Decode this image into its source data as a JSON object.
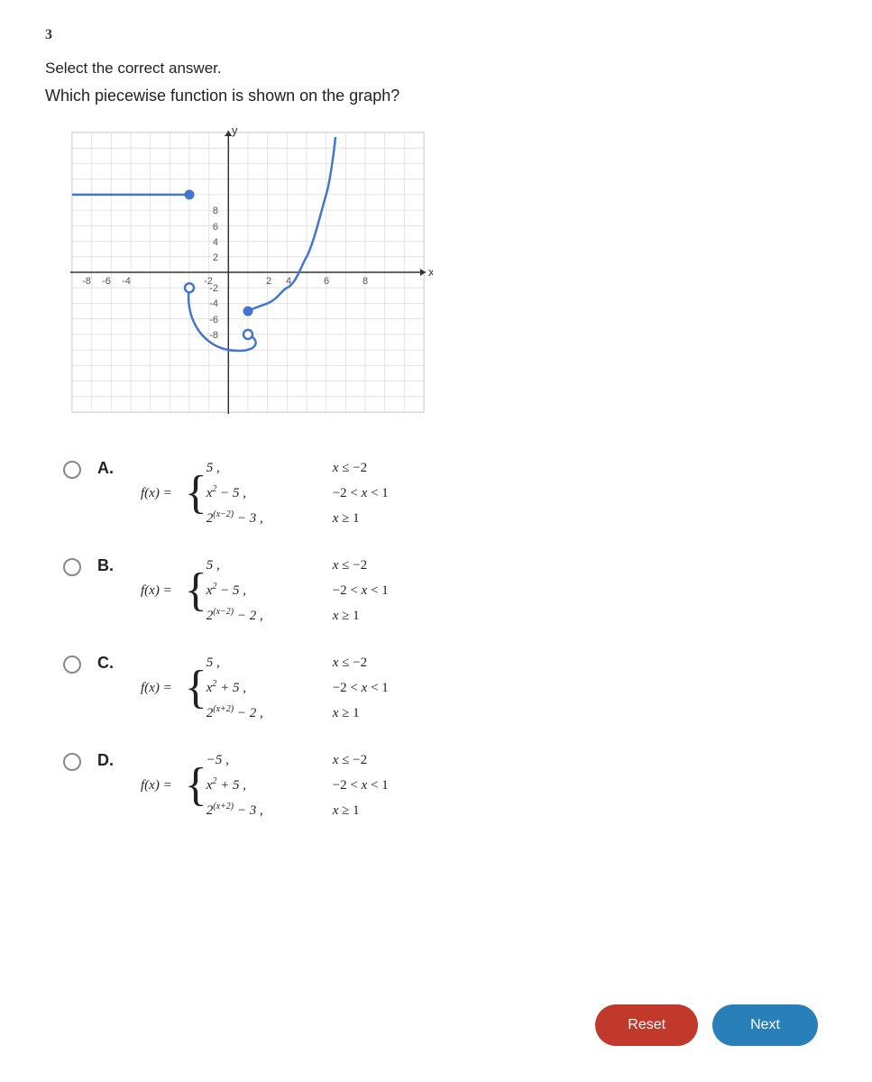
{
  "question": {
    "number": "3",
    "instruction": "Select the correct answer.",
    "text": "Which piecewise function is shown on the graph?"
  },
  "answers": [
    {
      "id": "A",
      "selected": false,
      "pieces": [
        {
          "expr": "5 ,",
          "condition": "x ≤ −2"
        },
        {
          "expr": "x² − 5 ,",
          "condition": "−2 < x < 1"
        },
        {
          "expr": "2^(x−2) − 3 ,",
          "condition": "x ≥ 1"
        }
      ]
    },
    {
      "id": "B",
      "selected": false,
      "pieces": [
        {
          "expr": "5 ,",
          "condition": "x ≤ −2"
        },
        {
          "expr": "x² − 5 ,",
          "condition": "−2 < x < 1"
        },
        {
          "expr": "2^(x−2) − 2 ,",
          "condition": "x ≥ 1"
        }
      ]
    },
    {
      "id": "C",
      "selected": false,
      "pieces": [
        {
          "expr": "5 ,",
          "condition": "x ≤ −2"
        },
        {
          "expr": "x² + 5 ,",
          "condition": "−2 < x < 1"
        },
        {
          "expr": "2^(x+2) − 2 ,",
          "condition": "x ≥ 1"
        }
      ]
    },
    {
      "id": "D",
      "selected": false,
      "pieces": [
        {
          "expr": "−5 ,",
          "condition": "x ≤ −2"
        },
        {
          "expr": "x² + 5 ,",
          "condition": "−2 < x < 1"
        },
        {
          "expr": "2^(x+2) − 3 ,",
          "condition": "x ≥ 1"
        }
      ]
    }
  ],
  "buttons": {
    "reset": "Reset",
    "next": "Next"
  }
}
